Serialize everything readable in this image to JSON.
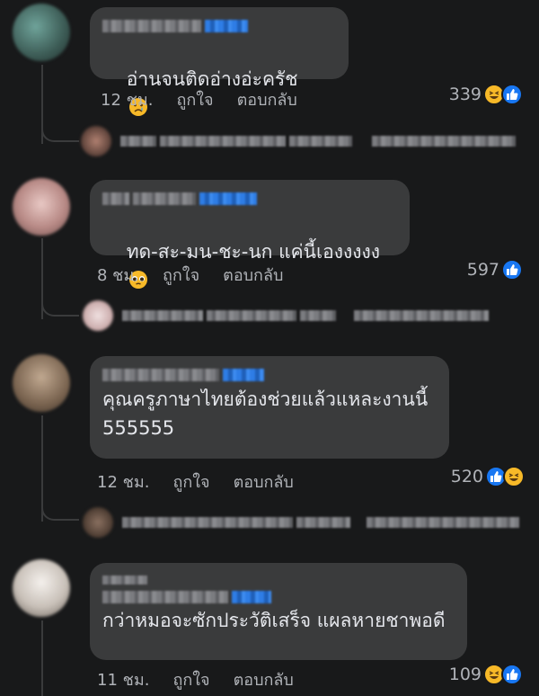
{
  "comments": [
    {
      "text": "อ่านจนติดอ่างอ่ะครัช",
      "emoji": "crying-face",
      "time": "12 ชม.",
      "like_label": "ถูกใจ",
      "reply_label": "ตอบกลับ",
      "reaction_count": "339",
      "reactions": [
        "haha",
        "like"
      ]
    },
    {
      "text": "ทด-สะ-มน-ชะ-นก แค่นี้เองงงงง",
      "emoji": "pleading-face",
      "time": "8 ชม.",
      "like_label": "ถูกใจ",
      "reply_label": "ตอบกลับ",
      "reaction_count": "597",
      "reactions": [
        "like"
      ]
    },
    {
      "text": "คุณครูภาษาไทยต้องช่วยแล้วแหละงานนี้\n555555",
      "emoji": "",
      "time": "12 ชม.",
      "like_label": "ถูกใจ",
      "reply_label": "ตอบกลับ",
      "reaction_count": "520",
      "reactions": [
        "like",
        "haha"
      ]
    },
    {
      "text": "กว่าหมอจะซักประวัติเสร็จ แผลหายชาพอดี",
      "emoji": "",
      "time": "11 ชม.",
      "like_label": "ถูกใจ",
      "reply_label": "ตอบกลับ",
      "reaction_count": "109",
      "reactions": [
        "haha",
        "like"
      ]
    }
  ],
  "colors": {
    "background": "#18191a",
    "bubble": "#3a3b3c",
    "text": "#e4e6eb",
    "meta": "#b0b3b8",
    "like_blue": "#1877f2",
    "emoji_yellow": "#f7b928"
  }
}
